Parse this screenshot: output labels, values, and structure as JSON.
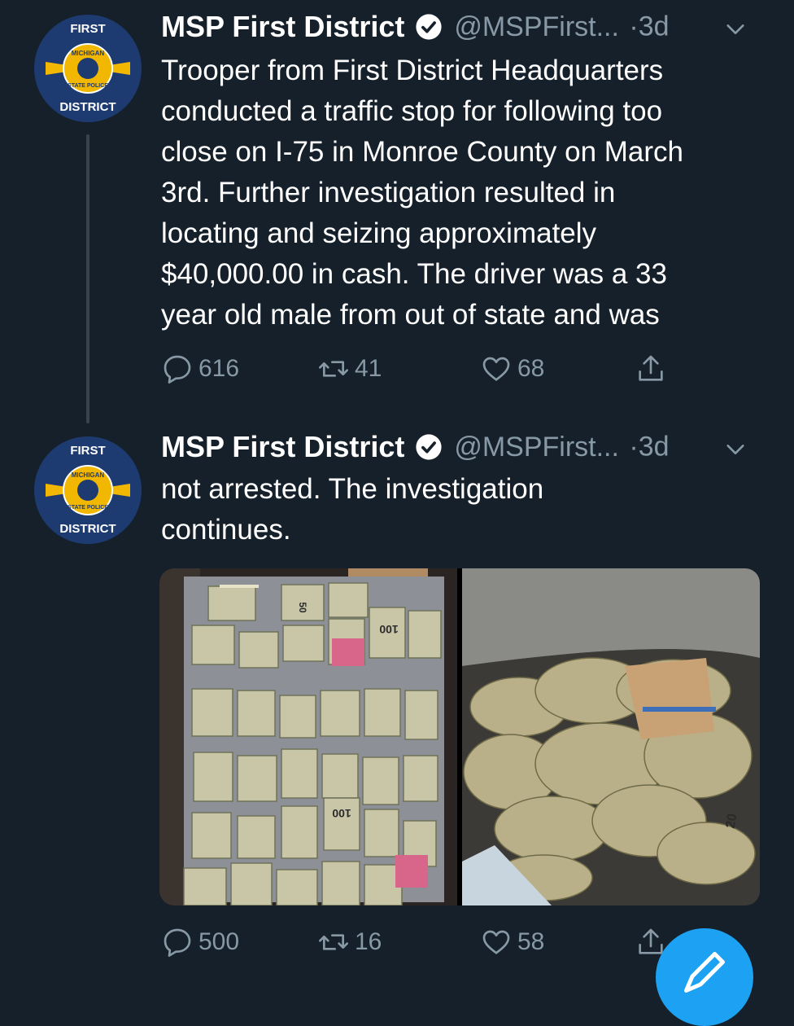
{
  "tweets": [
    {
      "name": "MSP First District",
      "handle": "@MSPFirst...",
      "separator": "·",
      "time": "3d",
      "avatar_text": {
        "top": "FIRST",
        "ring": "MICHIGAN",
        "badge": "STATE POLICE",
        "bottom": "DISTRICT"
      },
      "lines": [
        "Trooper from First District Headquarters",
        "conducted a traffic stop for following too",
        "close on I-75 in Monroe County on March",
        "3rd.  Further investigation resulted in",
        "locating and seizing approximately",
        "$40,000.00 in cash.  The driver was a 33",
        "year old male from out of state and was"
      ],
      "replies": "616",
      "retweets": "41",
      "likes": "68"
    },
    {
      "name": "MSP First District",
      "handle": "@MSPFirst...",
      "separator": "·",
      "time": "3d",
      "avatar_text": {
        "top": "FIRST",
        "ring": "MICHIGAN",
        "badge": "STATE POLICE",
        "bottom": "DISTRICT"
      },
      "lines": [
        "not arrested. The investigation",
        "continues."
      ],
      "replies": "500",
      "retweets": "16",
      "likes": "58",
      "photo_labels": {
        "left_a": "100",
        "left_b": "100",
        "left_c": "50",
        "right_a": "20"
      }
    }
  ],
  "colors": {
    "background": "#15202b",
    "secondary_text": "#8899a6",
    "accent": "#1da1f2"
  },
  "icons": [
    "verified-badge-icon",
    "chevron-down-icon",
    "reply-icon",
    "retweet-icon",
    "like-icon",
    "share-icon",
    "compose-icon"
  ]
}
